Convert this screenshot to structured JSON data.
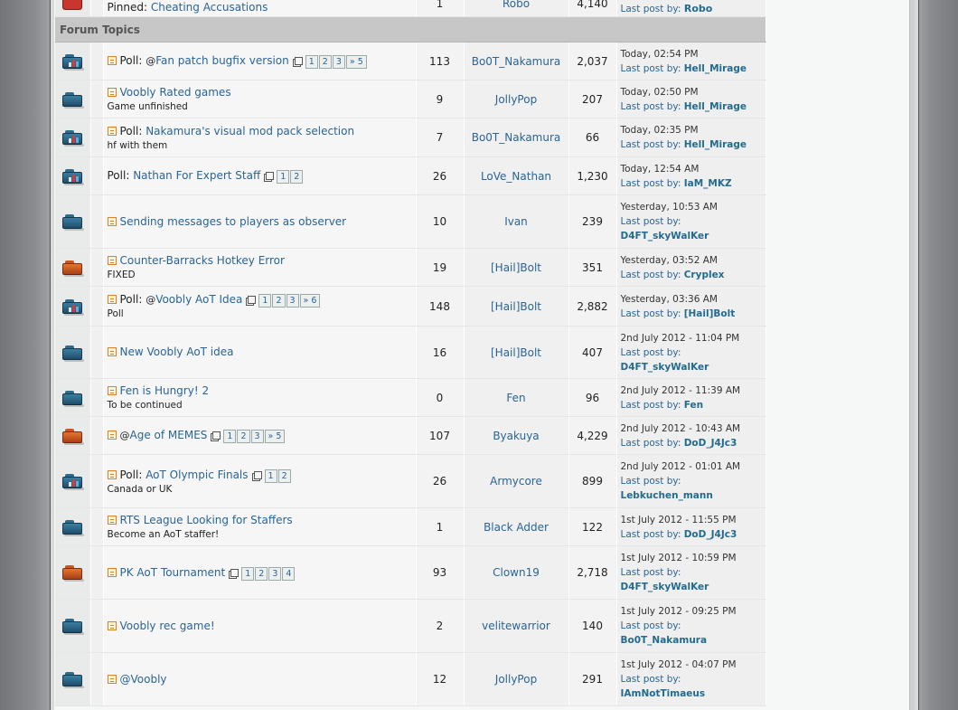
{
  "pinned_row": {
    "prefix": "Pinned:",
    "title": "Cheating Accusations",
    "replies": "1",
    "author": "Robo",
    "views": "4,140",
    "last_post_label": "Last post by:",
    "last_post_user": "Robo"
  },
  "section_title": "Forum Topics",
  "topics": [
    {
      "icon": "poll-folder-icon",
      "new": true,
      "poll": true,
      "poll_label": "Poll:",
      "attach": true,
      "title": "Fan patch bugfix version",
      "desc": "",
      "pages": [
        "1",
        "2",
        "3",
        "» 5"
      ],
      "replies": "113",
      "author": "Bo0T_Nakamura",
      "views": "2,037",
      "last_date": "Today, 02:54 PM",
      "last_label": "Last post by:",
      "last_user": "Hell_Mirage",
      "last_wrap": false,
      "h": 42
    },
    {
      "icon": "folder-icon",
      "new": true,
      "poll": false,
      "poll_label": "",
      "attach": false,
      "title": "Voobly Rated games",
      "desc": "Game unfinished",
      "pages": [],
      "replies": "9",
      "author": "JollyPop",
      "views": "207",
      "last_date": "Today, 02:50 PM",
      "last_label": "Last post by:",
      "last_user": "Hell_Mirage",
      "last_wrap": false,
      "h": 42
    },
    {
      "icon": "poll-folder-icon",
      "new": true,
      "poll": true,
      "poll_label": "Poll:",
      "attach": false,
      "title": "Nakamura's visual mod pack selection",
      "desc": "hf with them",
      "pages": [],
      "replies": "7",
      "author": "Bo0T_Nakamura",
      "views": "66",
      "last_date": "Today, 02:35 PM",
      "last_label": "Last post by:",
      "last_user": "Hell_Mirage",
      "last_wrap": false,
      "h": 43
    },
    {
      "icon": "poll-folder-icon",
      "new": false,
      "poll": true,
      "poll_label": "Poll:",
      "attach": false,
      "title": "Nathan For Expert Staff",
      "desc": "",
      "pages": [
        "1",
        "2"
      ],
      "replies": "26",
      "author": "LoVe_Nathan",
      "views": "1,230",
      "last_date": "Today, 12:54 AM",
      "last_label": "Last post by:",
      "last_user": "IaM_MKZ",
      "last_wrap": false,
      "h": 42
    },
    {
      "icon": "folder-icon",
      "new": true,
      "poll": false,
      "poll_label": "",
      "attach": false,
      "title": "Sending messages to players as observer",
      "desc": "",
      "pages": [],
      "replies": "10",
      "author": "Ivan",
      "views": "239",
      "last_date": "Yesterday, 10:53 AM",
      "last_label": "Last post by:",
      "last_user": "D4FT_skyWalKer",
      "last_wrap": true,
      "h": 59
    },
    {
      "icon": "hot-folder-icon",
      "new": true,
      "poll": false,
      "poll_label": "",
      "attach": false,
      "title": "Counter-Barracks Hotkey Error",
      "desc": "FIXED",
      "pages": [],
      "replies": "19",
      "author": "[Hail]Bolt",
      "views": "351",
      "last_date": "Yesterday, 03:52 AM",
      "last_label": "Last post by:",
      "last_user": "Cryplex",
      "last_wrap": false,
      "h": 42
    },
    {
      "icon": "poll-folder-icon",
      "new": true,
      "poll": true,
      "poll_label": "Poll:",
      "attach": true,
      "title": "Voobly AoT Idea",
      "desc": "Poll",
      "pages": [
        "1",
        "2",
        "3",
        "» 6"
      ],
      "replies": "148",
      "author": "[Hail]Bolt",
      "views": "2,882",
      "last_date": "Yesterday, 03:36 AM",
      "last_label": "Last post by:",
      "last_user": "[Hail]Bolt",
      "last_wrap": false,
      "h": 44
    },
    {
      "icon": "folder-icon",
      "new": true,
      "poll": false,
      "poll_label": "",
      "attach": false,
      "title": "New Voobly AoT idea",
      "desc": "",
      "pages": [],
      "replies": "16",
      "author": "[Hail]Bolt",
      "views": "407",
      "last_date": "2nd July 2012 - 11:04 PM",
      "last_label": "Last post by:",
      "last_user": "D4FT_skyWalKer",
      "last_wrap": true,
      "h": 58
    },
    {
      "icon": "folder-icon",
      "new": true,
      "poll": false,
      "poll_label": "",
      "attach": false,
      "title": "Fen is Hungry! 2",
      "desc": "To be continued",
      "pages": [],
      "replies": "0",
      "author": "Fen",
      "views": "96",
      "last_date": "2nd July 2012 - 11:39 AM",
      "last_label": "Last post by:",
      "last_user": "Fen",
      "last_wrap": false,
      "h": 42
    },
    {
      "icon": "hot-folder-icon",
      "new": true,
      "poll": false,
      "poll_label": "",
      "attach": true,
      "title": "Age of MEMES",
      "desc": "",
      "pages": [
        "1",
        "2",
        "3",
        "» 5"
      ],
      "replies": "107",
      "author": "Byakuya",
      "views": "4,229",
      "last_date": "2nd July 2012 - 10:43 AM",
      "last_label": "Last post by:",
      "last_user": "DoD_J4Jc3",
      "last_wrap": false,
      "h": 42
    },
    {
      "icon": "poll-folder-icon",
      "new": true,
      "poll": true,
      "poll_label": "Poll:",
      "attach": false,
      "title": "AoT Olympic Finals",
      "desc": "Canada or UK",
      "pages": [
        "1",
        "2"
      ],
      "replies": "26",
      "author": "Armycore",
      "views": "899",
      "last_date": "2nd July 2012 - 01:01 AM",
      "last_label": "Last post by:",
      "last_user": "Lebkuchen_mann",
      "last_wrap": true,
      "h": 59
    },
    {
      "icon": "folder-icon",
      "new": true,
      "poll": false,
      "poll_label": "",
      "attach": false,
      "title": "RTS League Looking for Staffers",
      "desc": "Become an AoT staffer!",
      "pages": [],
      "replies": "1",
      "author": "Black Adder",
      "views": "122",
      "last_date": "1st July 2012 - 11:55 PM",
      "last_label": "Last post by:",
      "last_user": "DoD_J4Jc3",
      "last_wrap": false,
      "h": 42
    },
    {
      "icon": "hot-folder-icon",
      "new": true,
      "poll": false,
      "poll_label": "",
      "attach": false,
      "title": "PK AoT Tournament",
      "desc": "",
      "pages": [
        "1",
        "2",
        "3",
        "4"
      ],
      "replies": "93",
      "author": "Clown19",
      "views": "2,718",
      "last_date": "1st July 2012 - 10:59 PM",
      "last_label": "Last post by:",
      "last_user": "D4FT_skyWalKer",
      "last_wrap": true,
      "h": 59
    },
    {
      "icon": "folder-icon",
      "new": true,
      "poll": false,
      "poll_label": "",
      "attach": false,
      "title": "Voobly rec game!",
      "desc": "",
      "pages": [],
      "replies": "2",
      "author": "velitewarrior",
      "views": "140",
      "last_date": "1st July 2012 - 09:25 PM",
      "last_label": "Last post by:",
      "last_user": "Bo0T_Nakamura",
      "last_wrap": true,
      "h": 59
    },
    {
      "icon": "folder-icon",
      "new": true,
      "poll": false,
      "poll_label": "",
      "attach": false,
      "title": "@Voobly",
      "desc": "",
      "pages": [],
      "replies": "12",
      "author": "JollyPop",
      "views": "291",
      "last_date": "1st July 2012 - 04:07 PM",
      "last_label": "Last post by:",
      "last_user": "IAmNotTimaeus",
      "last_wrap": true,
      "h": 59
    }
  ]
}
